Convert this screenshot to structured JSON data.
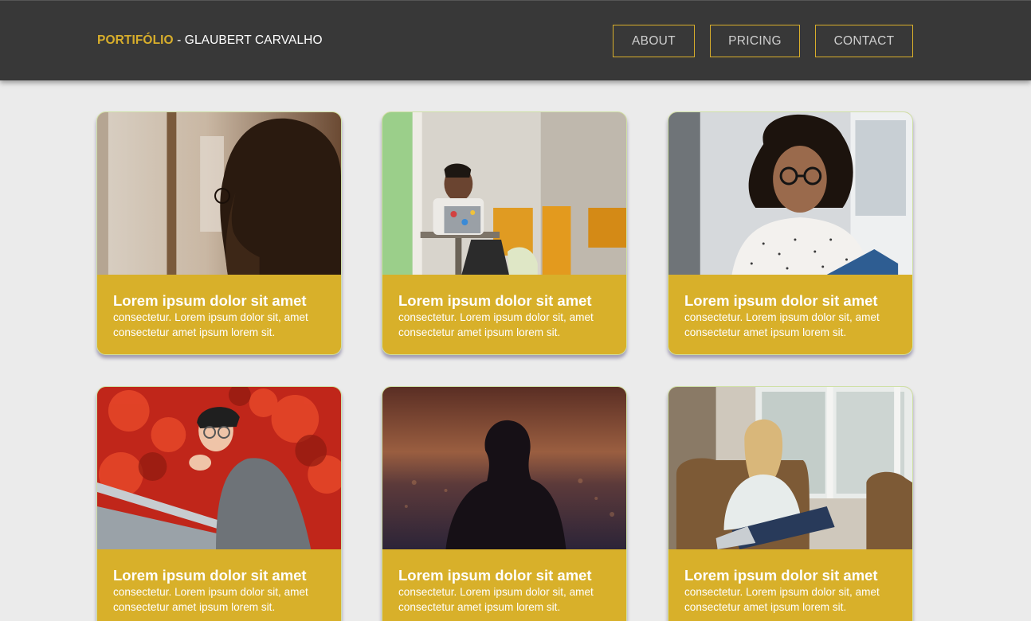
{
  "header": {
    "brand_accent": "PORTIFÓLIO",
    "brand_rest": " - GLAUBERT CARVALHO",
    "nav": [
      "ABOUT",
      "PRICING",
      "CONTACT"
    ]
  },
  "colors": {
    "accent": "#d8ae2b",
    "header_bg": "#383838",
    "page_bg": "#ebebeb",
    "card_body": "#d8b02a"
  },
  "cards": [
    {
      "title": "Lorem ipsum dolor sit amet",
      "desc": "consectetur. Lorem ipsum dolor sit, amet consectetur amet ipsum lorem sit.",
      "photo": "woman-with-glasses-profile-photo"
    },
    {
      "title": "Lorem ipsum dolor sit amet",
      "desc": "consectetur. Lorem ipsum dolor sit, amet consectetur amet ipsum lorem sit.",
      "photo": "man-with-laptop-photo"
    },
    {
      "title": "Lorem ipsum dolor sit amet",
      "desc": "consectetur. Lorem ipsum dolor sit, amet consectetur amet ipsum lorem sit.",
      "photo": "curly-hair-woman-reading-photo"
    },
    {
      "title": "Lorem ipsum dolor sit amet",
      "desc": "consectetur. Lorem ipsum dolor sit, amet consectetur amet ipsum lorem sit.",
      "photo": "woman-red-foliage-photo"
    },
    {
      "title": "Lorem ipsum dolor sit amet",
      "desc": "consectetur. Lorem ipsum dolor sit, amet consectetur amet ipsum lorem sit.",
      "photo": "woman-sunset-view-photo"
    },
    {
      "title": "Lorem ipsum dolor sit amet",
      "desc": "consectetur. Lorem ipsum dolor sit, amet consectetur amet ipsum lorem sit.",
      "photo": "woman-armchair-window-photo"
    }
  ]
}
